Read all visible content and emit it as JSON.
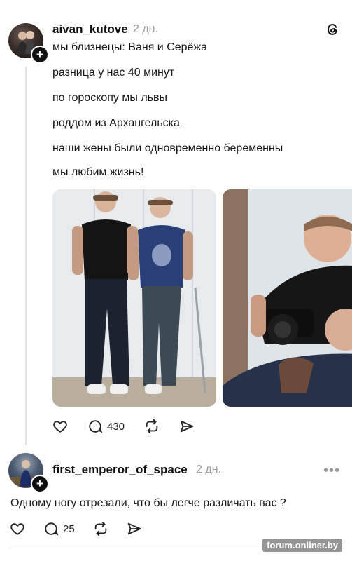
{
  "post": {
    "username": "aivan_kutove",
    "time": "2 дн.",
    "lines": [
      "мы близнецы: Ваня и Серёжа",
      "разница у нас 40 минут",
      "по гороскопу мы львы",
      "роддом из Архангельска",
      "наши жены были одновременно беременны",
      "мы любим жизнь!"
    ],
    "reply_count": "430"
  },
  "comment": {
    "username": "first_emperor_of_space",
    "time": "2 дн.",
    "text": "Одному ногу отрезали, что бы легче различать вас ?",
    "reply_count": "25"
  },
  "watermark": "forum.onliner.by"
}
